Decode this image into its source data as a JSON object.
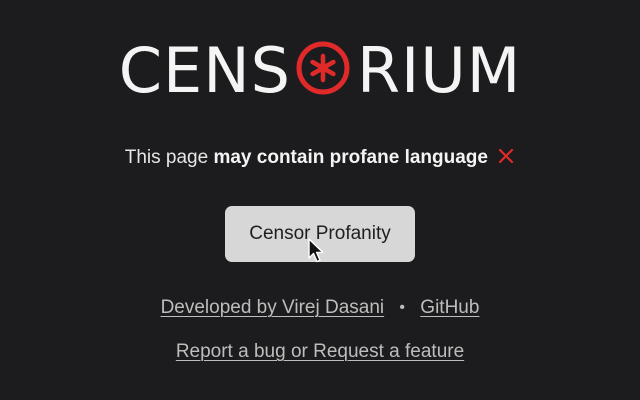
{
  "logo": {
    "prefix": "CENS",
    "suffix": "RIUM",
    "accent_color": "#e02a2a",
    "o_icon": "asterisk-circle-icon"
  },
  "status": {
    "plain_text": "This page",
    "strong_text": "may contain profane language",
    "status_icon": "x-icon",
    "status_color": "#e02a2a"
  },
  "action": {
    "button_label": "Censor Profanity"
  },
  "footer": {
    "developer_link": "Developed by Virej Dasani",
    "separator": "•",
    "github_link": "GitHub",
    "feedback_link": "Report a bug or Request a feature"
  }
}
